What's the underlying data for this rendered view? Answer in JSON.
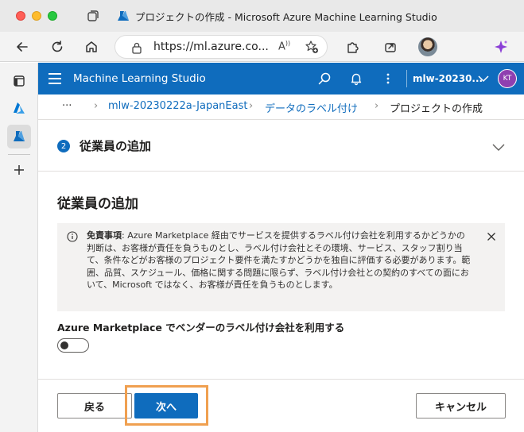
{
  "window": {
    "title": "プロジェクトの作成 - Microsoft Azure Machine Learning Studio"
  },
  "browser": {
    "url": "https://ml.azure.co...",
    "read_aloud_label": "À"
  },
  "app": {
    "title": "Machine Learning Studio",
    "workspace": "mlw-20230...",
    "user_initials": "KT",
    "brand_color": "#0f6cbd"
  },
  "breadcrumb": {
    "more": "···",
    "items": [
      "mlw-20230222a-JapanEast",
      "データのラベル付け",
      "プロジェクトの作成"
    ]
  },
  "step": {
    "number": "2",
    "title": "従業員の追加"
  },
  "section": {
    "title": "従業員の追加"
  },
  "notice": {
    "bold": "免責事項",
    "text": ": Azure Marketplace 経由でサービスを提供するラベル付け会社を利用するかどうかの判断は、お客様が責任を負うものとし、ラベル付け会社とその環境、サービス、スタッフ割り当て、条件などがお客様のプロジェクト要件を満たすかどうかを独自に評価する必要があります。範囲、品質、スケジュール、価格に関する問題に限らず、ラベル付け会社との契約のすべての面において、Microsoft ではなく、お客様が責任を負うものとします。"
  },
  "toggle": {
    "label": "Azure Marketplace でベンダーのラベル付け会社を利用する",
    "state": "off"
  },
  "footer": {
    "back_label": "戻る",
    "next_label": "次へ",
    "cancel_label": "キャンセル",
    "highlight_color": "#f0a050"
  }
}
